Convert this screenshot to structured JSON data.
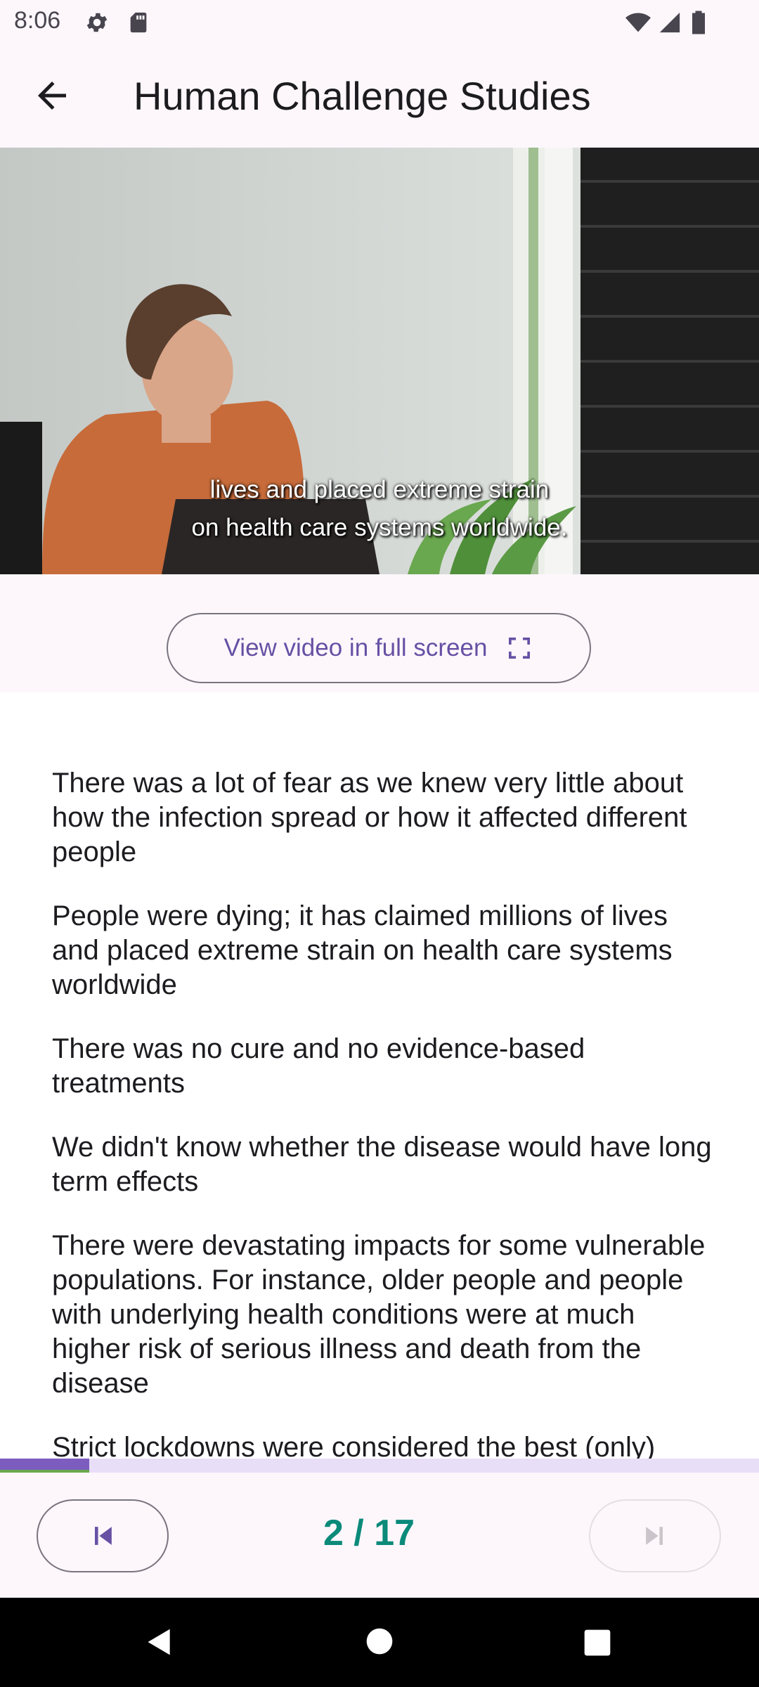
{
  "status_bar": {
    "time": "8:06",
    "icons": [
      "settings-gear-icon",
      "sd-card-icon",
      "wifi-icon",
      "cell-signal-icon",
      "battery-icon"
    ]
  },
  "app_bar": {
    "back_icon": "arrow-left-icon",
    "title": "Human Challenge Studies"
  },
  "video": {
    "subtitle_line1": "lives and placed extreme strain",
    "subtitle_line2": "on health care systems worldwide."
  },
  "fullscreen_button": {
    "label": "View video in full screen",
    "icon": "fullscreen-icon"
  },
  "content": {
    "paragraphs": [
      "There was a lot of fear as we knew very little about how the infection spread or how it affected different people",
      "People were dying; it has claimed millions of lives and placed extreme strain on health care systems worldwide",
      "There was no cure and no evidence-based treatments",
      "We didn't know whether the disease would have long term effects",
      "There were devastating impacts for some vulnerable populations. For instance, older people and people with underlying health conditions were at much higher risk of serious illness and death from the disease",
      "Strict lockdowns were considered the best (only)"
    ]
  },
  "progress": {
    "fraction": 0.1176
  },
  "pager": {
    "text": "2 / 17",
    "prev_icon": "skip-previous-icon",
    "next_icon": "skip-next-icon",
    "next_enabled": false
  },
  "colors": {
    "accent": "#6750a4",
    "pager_text": "#0b8a7a",
    "surface": "#fdf7fc"
  }
}
